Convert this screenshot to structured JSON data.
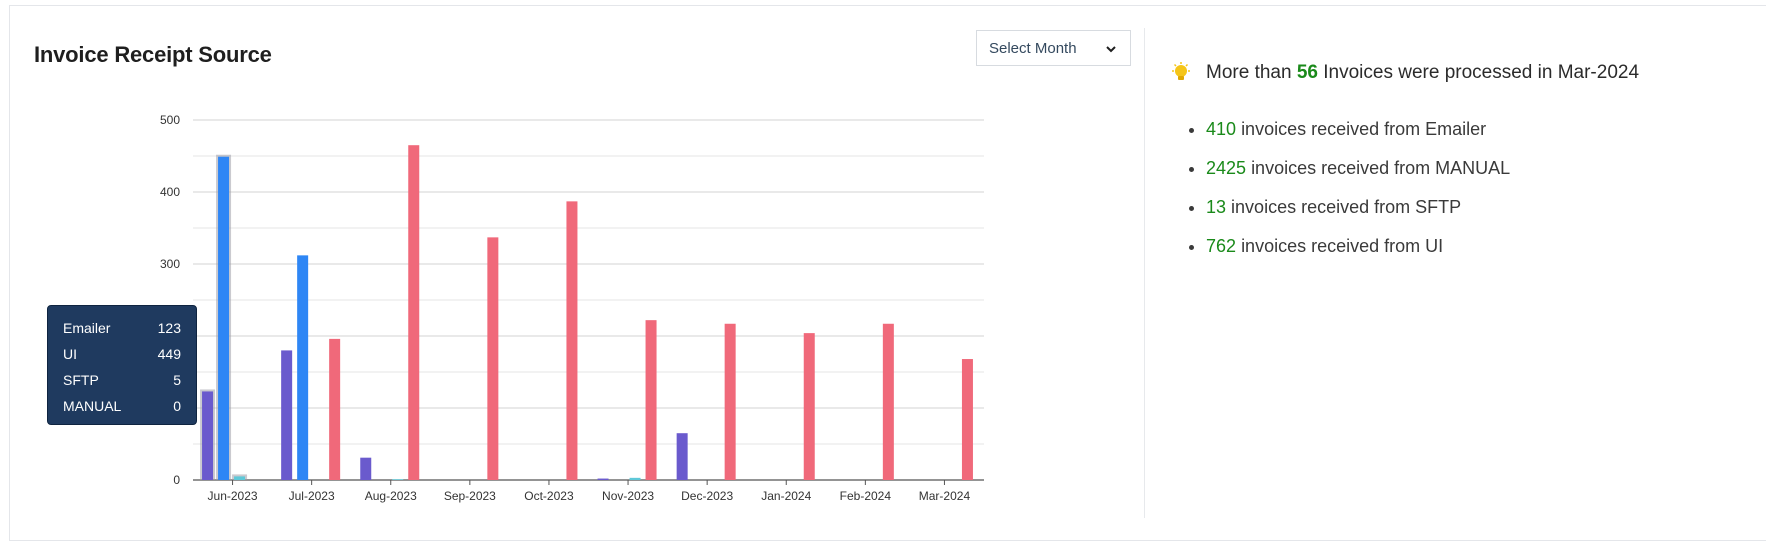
{
  "title": "Invoice Receipt Source",
  "select": {
    "label": "Select Month"
  },
  "insight": {
    "prefix": "More than",
    "count": "56",
    "suffix": "Invoices were processed in Mar-2024"
  },
  "summary": [
    {
      "value": "410",
      "text": "invoices received from Emailer"
    },
    {
      "value": "2425",
      "text": "invoices received from MANUAL"
    },
    {
      "value": "13",
      "text": "invoices received from SFTP"
    },
    {
      "value": "762",
      "text": "invoices received from UI"
    }
  ],
  "tooltip": {
    "rows": [
      {
        "name": "Emailer",
        "value": "123"
      },
      {
        "name": "UI",
        "value": "449"
      },
      {
        "name": "SFTP",
        "value": "5"
      },
      {
        "name": "MANUAL",
        "value": "0"
      }
    ]
  },
  "colors": {
    "emailer": "#6a5acd",
    "ui": "#2e86f5",
    "sftp": "#5ec8d8",
    "manual": "#f0697a",
    "highlight": "#9e9ea8"
  },
  "chart_data": {
    "type": "bar",
    "categories": [
      "Jun-2023",
      "Jul-2023",
      "Aug-2023",
      "Sep-2023",
      "Oct-2023",
      "Nov-2023",
      "Dec-2023",
      "Jan-2024",
      "Feb-2024",
      "Mar-2024"
    ],
    "series": [
      {
        "name": "Emailer",
        "color": "#6a5acd",
        "values": [
          123,
          180,
          31,
          0,
          0,
          2,
          65,
          0,
          0,
          0
        ]
      },
      {
        "name": "UI",
        "color": "#2e86f5",
        "values": [
          449,
          312,
          0,
          0,
          0,
          0,
          0,
          0,
          0,
          0
        ]
      },
      {
        "name": "SFTP",
        "color": "#5ec8d8",
        "values": [
          5,
          0,
          1,
          0,
          0,
          3,
          0,
          0,
          0,
          0
        ]
      },
      {
        "name": "MANUAL",
        "color": "#f0697a",
        "values": [
          0,
          196,
          465,
          337,
          387,
          222,
          217,
          204,
          217,
          168
        ]
      }
    ],
    "yticks": [
      0,
      100,
      200,
      300,
      400,
      500
    ],
    "ytick_labels": [
      "0",
      "",
      "",
      "300",
      "400",
      "500"
    ],
    "ylim": [
      0,
      500
    ],
    "grid": true,
    "highlighted_category": "Jun-2023"
  }
}
